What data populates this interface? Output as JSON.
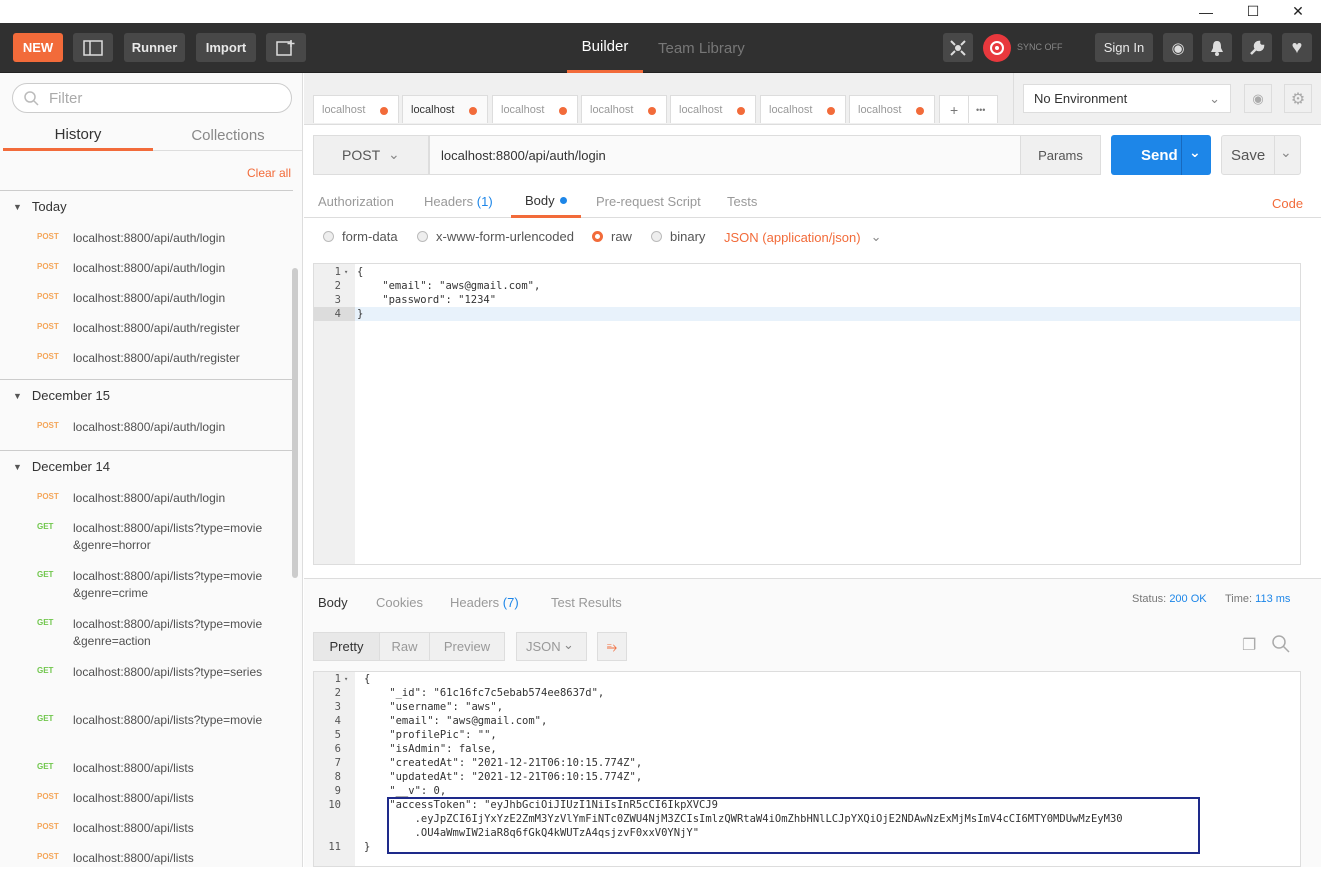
{
  "window": {
    "minimize": "—",
    "maximize": "☐",
    "close": "✕"
  },
  "header": {
    "new_label": "NEW",
    "runner_label": "Runner",
    "import_label": "Import",
    "tab_builder": "Builder",
    "tab_team_library": "Team Library",
    "sync_label": "SYNC OFF",
    "sign_in_label": "Sign In"
  },
  "sidebar": {
    "filter_placeholder": "Filter",
    "tab_history": "History",
    "tab_collections": "Collections",
    "clear_all": "Clear all",
    "groups": [
      {
        "label": "Today",
        "items": [
          {
            "method": "POST",
            "url": "localhost:8800/api/auth/login"
          },
          {
            "method": "POST",
            "url": "localhost:8800/api/auth/login"
          },
          {
            "method": "POST",
            "url": "localhost:8800/api/auth/login"
          },
          {
            "method": "POST",
            "url": "localhost:8800/api/auth/register"
          },
          {
            "method": "POST",
            "url": "localhost:8800/api/auth/register"
          }
        ]
      },
      {
        "label": "December 15",
        "items": [
          {
            "method": "POST",
            "url": "localhost:8800/api/auth/login"
          }
        ]
      },
      {
        "label": "December 14",
        "items": [
          {
            "method": "POST",
            "url": "localhost:8800/api/auth/login"
          },
          {
            "method": "GET",
            "url": "localhost:8800/api/lists?type=movie&genre=horror"
          },
          {
            "method": "GET",
            "url": "localhost:8800/api/lists?type=movie&genre=crime"
          },
          {
            "method": "GET",
            "url": "localhost:8800/api/lists?type=movie&genre=action"
          },
          {
            "method": "GET",
            "url": "localhost:8800/api/lists?type=series"
          },
          {
            "method": "GET",
            "url": "localhost:8800/api/lists?type=movie"
          },
          {
            "method": "GET",
            "url": "localhost:8800/api/lists"
          },
          {
            "method": "POST",
            "url": "localhost:8800/api/lists"
          },
          {
            "method": "POST",
            "url": "localhost:8800/api/lists"
          },
          {
            "method": "POST",
            "url": "localhost:8800/api/lists"
          }
        ]
      }
    ]
  },
  "request_tabs": [
    "localhost",
    "localhost",
    "localhost",
    "localhost",
    "localhost",
    "localhost",
    "localhost"
  ],
  "request_tabs_add": "+",
  "request_tabs_more": "•••",
  "environment": {
    "selected": "No Environment"
  },
  "request": {
    "method": "POST",
    "url": "localhost:8800/api/auth/login",
    "params_label": "Params",
    "send_label": "Send",
    "save_label": "Save"
  },
  "request_subtabs": {
    "authorization": "Authorization",
    "headers": "Headers",
    "headers_count": "(1)",
    "body": "Body",
    "prerequest": "Pre-request Script",
    "tests": "Tests",
    "code": "Code"
  },
  "body_options": {
    "form_data": "form-data",
    "urlencoded": "x-www-form-urlencoded",
    "raw": "raw",
    "binary": "binary",
    "content_type": "JSON (application/json)"
  },
  "request_body_lines": [
    {
      "n": "1",
      "text": "{"
    },
    {
      "n": "2",
      "text": "    \"email\": \"aws@gmail.com\","
    },
    {
      "n": "3",
      "text": "    \"password\": \"1234\""
    },
    {
      "n": "4",
      "text": "}"
    }
  ],
  "response": {
    "tab_body": "Body",
    "tab_cookies": "Cookies",
    "tab_headers": "Headers",
    "headers_count": "(7)",
    "tab_test_results": "Test Results",
    "status_label": "Status:",
    "status_value": "200 OK",
    "time_label": "Time:",
    "time_value": "113 ms",
    "fmt_pretty": "Pretty",
    "fmt_raw": "Raw",
    "fmt_preview": "Preview",
    "fmt_type": "JSON"
  },
  "response_body_lines": [
    {
      "n": "1",
      "text": "{"
    },
    {
      "n": "2",
      "text": "    \"_id\": \"61c16fc7c5ebab574ee8637d\","
    },
    {
      "n": "3",
      "text": "    \"username\": \"aws\","
    },
    {
      "n": "4",
      "text": "    \"email\": \"aws@gmail.com\","
    },
    {
      "n": "5",
      "text": "    \"profilePic\": \"\","
    },
    {
      "n": "6",
      "text": "    \"isAdmin\": false,"
    },
    {
      "n": "7",
      "text": "    \"createdAt\": \"2021-12-21T06:10:15.774Z\","
    },
    {
      "n": "8",
      "text": "    \"updatedAt\": \"2021-12-21T06:10:15.774Z\","
    },
    {
      "n": "9",
      "text": "    \"__v\": 0,"
    },
    {
      "n": "10",
      "text": "    \"accessToken\": \"eyJhbGciOiJIUzI1NiIsInR5cCI6IkpXVCJ9"
    },
    {
      "n": "",
      "text": "        .eyJpZCI6IjYxYzE2ZmM3YzVlYmFiNTc0ZWU4NjM3ZCIsImlzQWRtaW4iOmZhbHNlLCJpYXQiOjE2NDAwNzExMjMsImV4cCI6MTY0MDUwMzEyM30"
    },
    {
      "n": "",
      "text": "        .OU4aWmwIW2iaR8q6fGkQ4kWUTzA4qsjzvF0xxV0YNjY\""
    },
    {
      "n": "11",
      "text": "}"
    }
  ]
}
